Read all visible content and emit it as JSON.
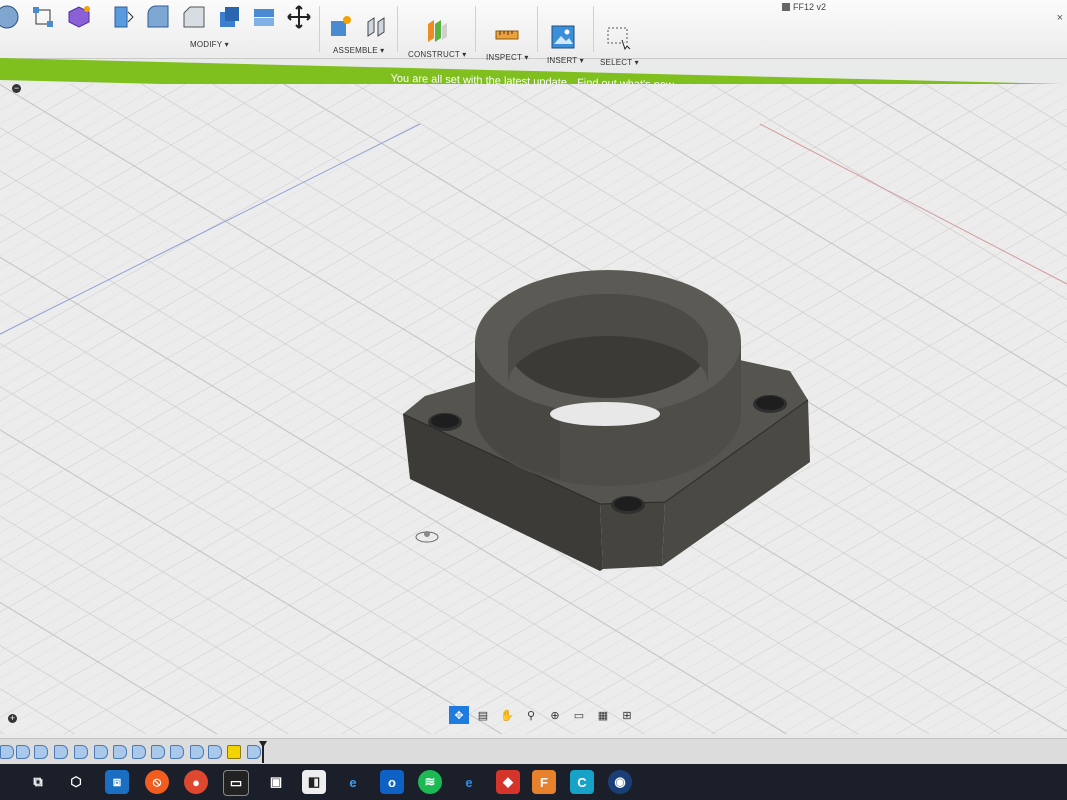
{
  "toolbar": {
    "groups": {
      "modify": "MODIFY ▾",
      "assemble": "ASSEMBLE ▾",
      "construct": "CONSTRUCT ▾",
      "inspect": "INSPECT ▾",
      "insert": "INSERT ▾",
      "select": "SELECT ▾"
    },
    "document_title": "FF12 v2",
    "close": "×"
  },
  "banner": {
    "message": "You are all set with the latest update.",
    "link": "Find out what's new."
  },
  "canvas": {
    "collapse_top": "−",
    "collapse_bottom": "+"
  },
  "navbar": {
    "icons": [
      "orbit-icon",
      "look-at-icon",
      "pan-icon",
      "zoom-icon",
      "fit-icon",
      "display-settings-icon",
      "grid-settings-icon",
      "viewports-icon"
    ]
  },
  "taskbar": {
    "apps": [
      "network-icon",
      "3d-viewer-icon",
      "app-icon",
      "brave-icon",
      "chrome-icon",
      "terminal-icon",
      "3d-builder-icon",
      "media-icon",
      "ie-icon",
      "outlook-icon",
      "spotify-icon",
      "edge-icon",
      "autodesk-icon",
      "fusion-icon",
      "c-icon",
      "wheel-icon"
    ]
  },
  "colors": {
    "banner": "#7fbf1e",
    "model": "#4a4945",
    "selection": "#1e7be0"
  }
}
